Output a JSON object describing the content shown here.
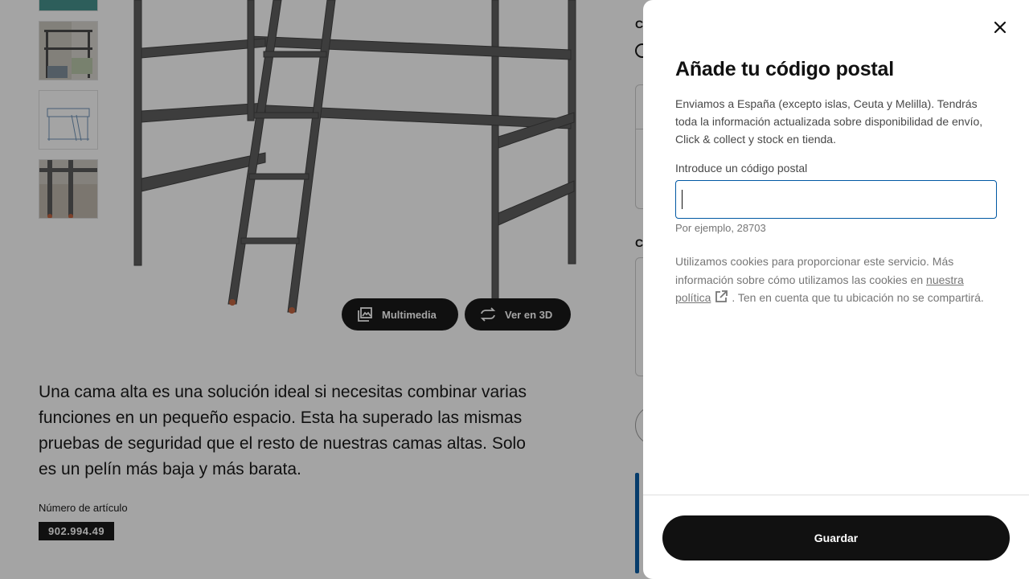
{
  "product_page": {
    "media_buttons": {
      "multimedia_label": "Multimedia",
      "view3d_label": "Ver en 3D"
    },
    "description": "Una cama alta es una solución ideal si necesitas combinar varias funciones en un pequeño espacio. Esta ha superado las mismas pruebas de seguridad que el resto de nuestras camas altas. Solo es un pelín más baja y más barata.",
    "article_number_label": "Número de artículo",
    "article_number": "902.994.49",
    "right_col_label_1": "Co",
    "right_col_label_2": "C"
  },
  "modal": {
    "title": "Añade tu código postal",
    "intro": "Enviamos a España (excepto islas, Ceuta y Melilla). Tendrás toda la información actualizada sobre disponibilidad de envío, Click & collect y stock en tienda.",
    "postal_field": {
      "label": "Introduce un código postal",
      "value": "",
      "hint": "Por ejemplo, 28703"
    },
    "cookie_text_before": "Utilizamos cookies para proporcionar este servicio. Más información sobre cómo utilizamos las cookies en",
    "cookie_link": "nuestra política",
    "cookie_text_after": ". Ten en cuenta que tu ubicación no se compartirá.",
    "save_label": "Guardar"
  },
  "colors": {
    "primary": "#111111",
    "focus_border": "#0058a3",
    "overlay": "rgba(17,17,17,0.38)"
  },
  "icons": [
    "close-icon",
    "gallery-icon",
    "rotate-3d-icon",
    "external-link-icon",
    "info-icon"
  ]
}
